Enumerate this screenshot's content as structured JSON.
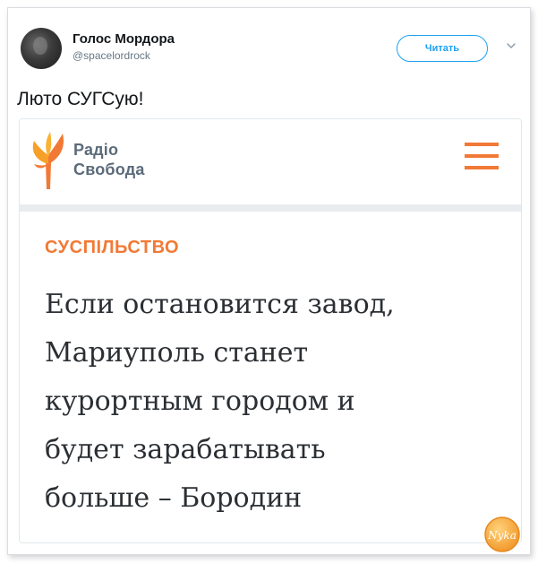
{
  "tweet": {
    "author": {
      "display_name": "Голос Мордора",
      "handle": "@spacelordrock"
    },
    "follow_label": "Читать",
    "text": "Люто СУГСую!",
    "card": {
      "logo": {
        "line1": "Радіо",
        "line2": "Свобода"
      },
      "category": "СУСПІЛЬСТВО",
      "headline_lines": [
        "Если остановится завод,",
        "Мариуполь станет",
        "курортным городом и",
        "будет зарабатывать",
        "больше – Бородин"
      ]
    }
  },
  "watermark": {
    "text": "Nyka"
  },
  "colors": {
    "accent_blue": "#1da1f2",
    "category_orange": "#f27935",
    "logo_gray": "#5c6b7a"
  },
  "icons": {
    "caret": "chevron-down-icon",
    "menu": "hamburger-menu-icon",
    "logo": "radio-svoboda-flame-icon"
  }
}
